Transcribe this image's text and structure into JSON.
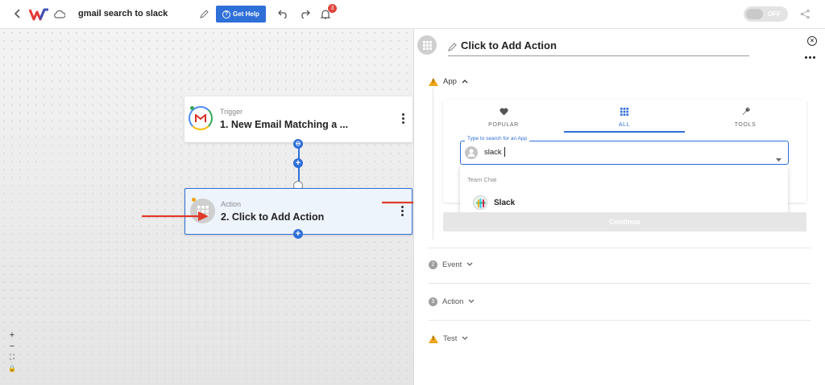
{
  "header": {
    "workflow_name": "gmail search to slack",
    "help_label": "Get Help",
    "notification_count": "3",
    "toggle_label": "OFF"
  },
  "canvas": {
    "trigger": {
      "subtitle": "Trigger",
      "title": "1. New Email Matching a ..."
    },
    "action": {
      "subtitle": "Action",
      "title": "2. Click to Add Action"
    },
    "zoom_controls": [
      "+",
      "−",
      "⛶",
      "🔒"
    ]
  },
  "panel": {
    "title": "Click to Add Action",
    "sections": {
      "app": "App",
      "event": "Event",
      "action": "Action",
      "test": "Test"
    },
    "step_numbers": {
      "event": "2",
      "action": "3"
    },
    "tabs": [
      {
        "label": "POPULAR",
        "icon": "heart-icon"
      },
      {
        "label": "ALL",
        "icon": "grid-icon"
      },
      {
        "label": "TOOLS",
        "icon": "wrench-icon"
      }
    ],
    "search": {
      "floating_label": "Type to search for an App",
      "value": "slack"
    },
    "results": {
      "group_label": "Team Chat",
      "items": [
        {
          "label": "Slack",
          "icon": "slack-icon"
        }
      ]
    },
    "continue_label": "Continue"
  },
  "colors": {
    "accent": "#2f6fd8",
    "badge": "#e0443a",
    "warning": "#f0a416",
    "annotation_arrow": "#e03a2a"
  }
}
